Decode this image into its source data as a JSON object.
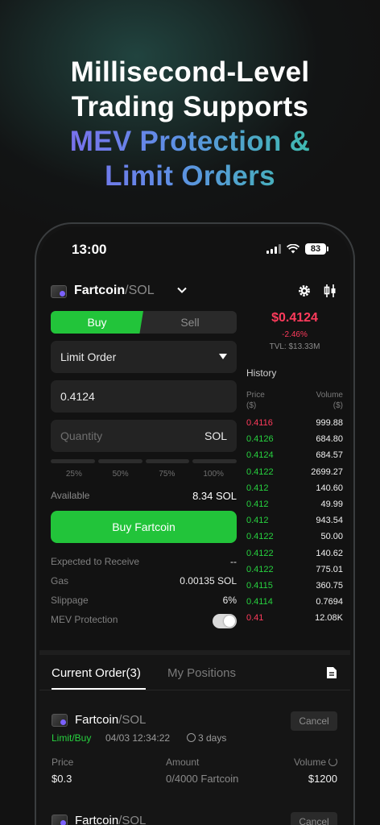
{
  "headline": {
    "line1": "Millisecond-Level",
    "line2": "Trading Supports",
    "line3": "MEV Protection &",
    "line4": "Limit Orders"
  },
  "status_bar": {
    "time": "13:00",
    "battery": "83"
  },
  "pair": {
    "base": "Fartcoin",
    "quote": "/SOL"
  },
  "trade": {
    "buy_label": "Buy",
    "sell_label": "Sell",
    "order_type": "Limit Order",
    "price_value": "0.4124",
    "quantity_placeholder": "Quantity",
    "quantity_unit": "SOL",
    "percentages": [
      "25%",
      "50%",
      "75%",
      "100%"
    ],
    "available_label": "Available",
    "available_value": "8.34 SOL",
    "submit_label": "Buy Fartcoin",
    "expected_label": "Expected to Receive",
    "expected_value": "--",
    "gas_label": "Gas",
    "gas_value": "0.00135 SOL",
    "slippage_label": "Slippage",
    "slippage_value": "6%",
    "mev_label": "MEV Protection",
    "mev_enabled": true
  },
  "market": {
    "last_price": "$0.4124",
    "change": "-2.46%",
    "tvl": "TVL: $13.33M"
  },
  "history": {
    "title": "History",
    "price_header_1": "Price",
    "price_header_2": "($)",
    "volume_header_1": "Volume",
    "volume_header_2": "($)",
    "rows": [
      {
        "price": "0.4116",
        "volume": "999.88",
        "side": "sell"
      },
      {
        "price": "0.4126",
        "volume": "684.80",
        "side": "buy"
      },
      {
        "price": "0.4124",
        "volume": "684.57",
        "side": "buy"
      },
      {
        "price": "0.4122",
        "volume": "2699.27",
        "side": "buy"
      },
      {
        "price": "0.412",
        "volume": "140.60",
        "side": "buy"
      },
      {
        "price": "0.412",
        "volume": "49.99",
        "side": "buy"
      },
      {
        "price": "0.412",
        "volume": "943.54",
        "side": "buy"
      },
      {
        "price": "0.4122",
        "volume": "50.00",
        "side": "buy"
      },
      {
        "price": "0.4122",
        "volume": "140.62",
        "side": "buy"
      },
      {
        "price": "0.4122",
        "volume": "775.01",
        "side": "buy"
      },
      {
        "price": "0.4115",
        "volume": "360.75",
        "side": "buy"
      },
      {
        "price": "0.4114",
        "volume": "0.7694",
        "side": "buy"
      },
      {
        "price": "0.41",
        "volume": "12.08K",
        "side": "sell"
      }
    ]
  },
  "orders": {
    "tab_current": "Current Order(3)",
    "tab_positions": "My Positions",
    "items": [
      {
        "base": "Fartcoin",
        "quote": "/SOL",
        "type": "Limit/Buy",
        "datetime": "04/03 12:34:22",
        "duration": "3 days",
        "cancel_label": "Cancel",
        "price_label": "Price",
        "price_value": "$0.3",
        "amount_label": "Amount",
        "amount_value": "0/4000 Fartcoin",
        "volume_label": "Volume",
        "volume_value": "$1200"
      },
      {
        "base": "Fartcoin",
        "quote": "/SOL",
        "cancel_label": "Cancel"
      }
    ]
  },
  "colors": {
    "buy_green": "#22c43a",
    "sell_red": "#ff3b5c",
    "background": "#121212"
  },
  "icons": [
    "gear-icon",
    "candlestick-icon",
    "chevron-down-icon",
    "document-icon",
    "clock-icon",
    "refresh-icon"
  ]
}
